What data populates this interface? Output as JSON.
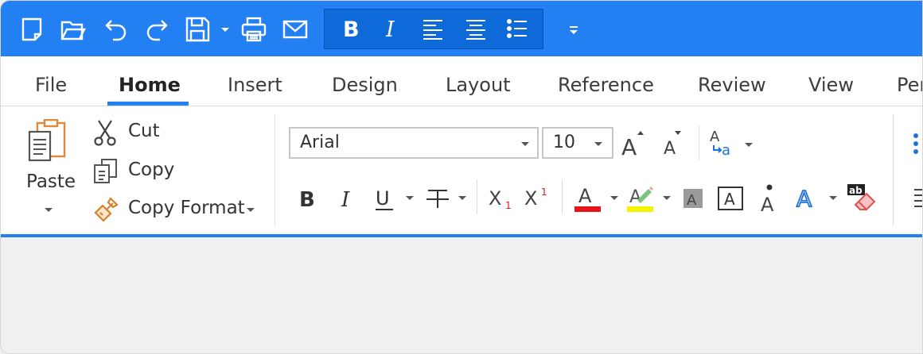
{
  "quick_access": {
    "icons": [
      "new-document-icon",
      "open-folder-icon",
      "undo-icon",
      "redo-icon",
      "save-icon",
      "print-icon",
      "email-icon",
      "bold-icon",
      "italic-icon",
      "align-left-icon",
      "align-center-icon",
      "bulleted-list-icon",
      "customize-dropdown-icon"
    ],
    "bar_color": "#2280f2",
    "format_group_color": "#0d6ad8"
  },
  "tabs": [
    {
      "label": "File"
    },
    {
      "label": "Home",
      "active": true
    },
    {
      "label": "Insert"
    },
    {
      "label": "Design"
    },
    {
      "label": "Layout"
    },
    {
      "label": "Reference"
    },
    {
      "label": "Review"
    },
    {
      "label": "View"
    },
    {
      "label": "Per"
    }
  ],
  "clipboard": {
    "paste_label": "Paste",
    "cut_label": "Cut",
    "copy_label": "Copy",
    "copy_format_label": "Copy Format"
  },
  "font": {
    "family": "Arial",
    "size": "10",
    "font_color_bar": "#e8141c",
    "highlight_color_bar": "#f4f400"
  }
}
